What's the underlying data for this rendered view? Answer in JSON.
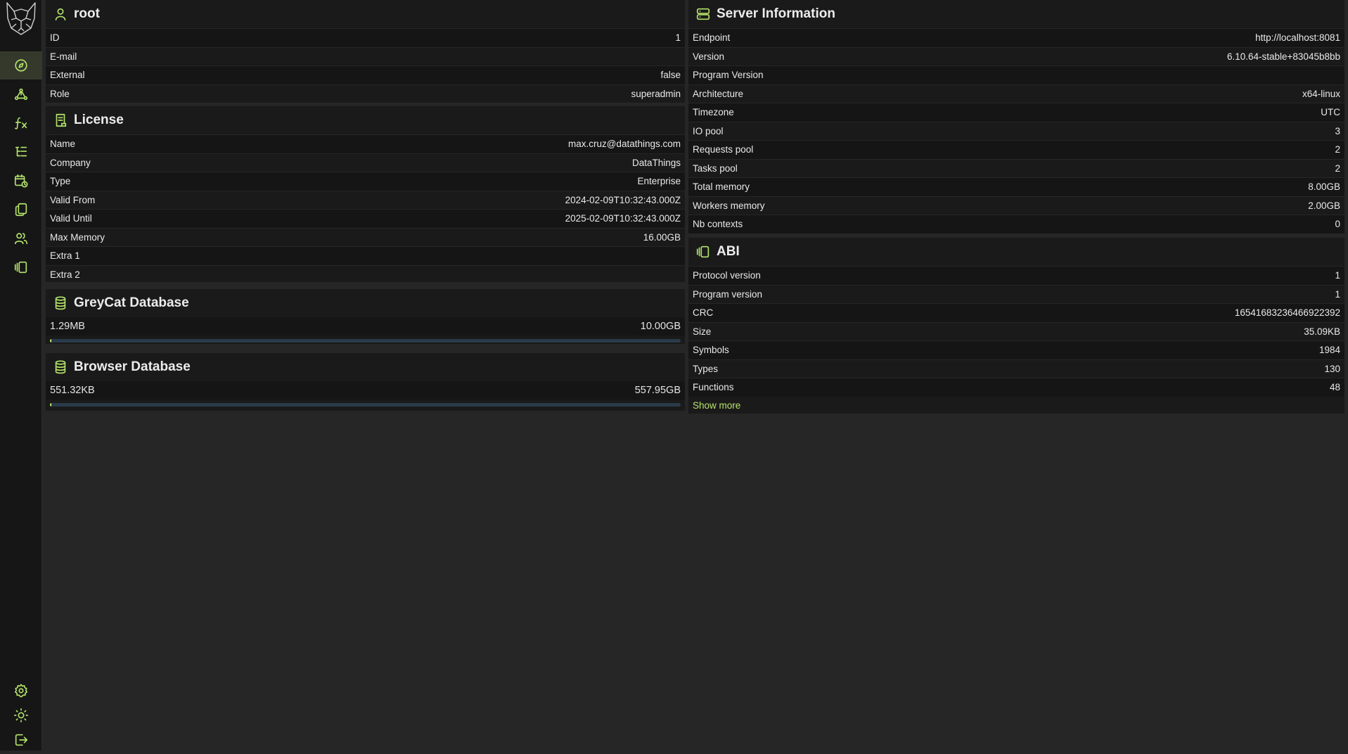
{
  "user": {
    "title": "root",
    "rows": [
      {
        "k": "ID",
        "v": "1"
      },
      {
        "k": "E-mail",
        "v": ""
      },
      {
        "k": "External",
        "v": "false"
      },
      {
        "k": "Role",
        "v": "superadmin"
      }
    ]
  },
  "license": {
    "title": "License",
    "rows": [
      {
        "k": "Name",
        "v": "max.cruz@datathings.com"
      },
      {
        "k": "Company",
        "v": "DataThings"
      },
      {
        "k": "Type",
        "v": "Enterprise"
      },
      {
        "k": "Valid From",
        "v": "2024-02-09T10:32:43.000Z"
      },
      {
        "k": "Valid Until",
        "v": "2025-02-09T10:32:43.000Z"
      },
      {
        "k": "Max Memory",
        "v": "16.00GB"
      },
      {
        "k": "Extra 1",
        "v": ""
      },
      {
        "k": "Extra 2",
        "v": ""
      }
    ]
  },
  "greycat_db": {
    "title": "GreyCat Database",
    "used": "1.29MB",
    "total": "10.00GB",
    "fill_fraction": 0.0002
  },
  "browser_db": {
    "title": "Browser Database",
    "used": "551.32KB",
    "total": "557.95GB",
    "fill_fraction": 1e-06
  },
  "server": {
    "title": "Server Information",
    "rows": [
      {
        "k": "Endpoint",
        "v": "http://localhost:8081"
      },
      {
        "k": "Version",
        "v": "6.10.64-stable+83045b8bb"
      },
      {
        "k": "Program Version",
        "v": ""
      },
      {
        "k": "Architecture",
        "v": "x64-linux"
      },
      {
        "k": "Timezone",
        "v": "UTC"
      },
      {
        "k": "IO pool",
        "v": "3"
      },
      {
        "k": "Requests pool",
        "v": "2"
      },
      {
        "k": "Tasks pool",
        "v": "2"
      },
      {
        "k": "Total memory",
        "v": "8.00GB"
      },
      {
        "k": "Workers memory",
        "v": "2.00GB"
      },
      {
        "k": "Nb contexts",
        "v": "0"
      }
    ]
  },
  "abi": {
    "title": "ABI",
    "rows": [
      {
        "k": "Protocol version",
        "v": "1"
      },
      {
        "k": "Program version",
        "v": "1"
      },
      {
        "k": "CRC",
        "v": "16541683236466922392"
      },
      {
        "k": "Size",
        "v": "35.09KB"
      },
      {
        "k": "Symbols",
        "v": "1984"
      },
      {
        "k": "Types",
        "v": "130"
      },
      {
        "k": "Functions",
        "v": "48"
      }
    ],
    "show_more": "Show more"
  },
  "nav": {
    "items": [
      "dashboard-icon",
      "graph-icon",
      "function-icon",
      "tree-icon",
      "calendar-clock-icon",
      "files-icon",
      "users-icon",
      "abi-icon"
    ],
    "bottom": [
      "settings-icon",
      "theme-sun-icon",
      "logout-icon"
    ]
  },
  "colors": {
    "accent": "#b4e36a",
    "background": "#262626",
    "card": "#1a1a1a",
    "sidebar": "#161616"
  }
}
